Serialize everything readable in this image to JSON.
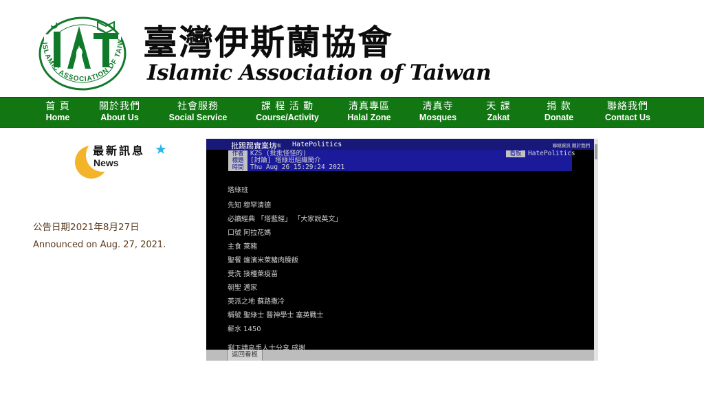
{
  "header": {
    "logo_letters": "IAT",
    "logo_ring_text": "ISLAMIC ASSOCIATION OF TAIWAN",
    "title_zh": "臺灣伊斯蘭協會",
    "title_en": "Islamic Association of Taiwan",
    "brand_green": "#127712"
  },
  "nav": {
    "items": [
      {
        "zh": "首 頁",
        "en": "Home"
      },
      {
        "zh": "關於我們",
        "en": "About Us"
      },
      {
        "zh": "社會服務",
        "en": "Social Service"
      },
      {
        "zh": "課 程 活 動",
        "en": "Course/Activity"
      },
      {
        "zh": "清真專區",
        "en": "Halal Zone"
      },
      {
        "zh": "清真寺",
        "en": "Mosques"
      },
      {
        "zh": "天 課",
        "en": "Zakat"
      },
      {
        "zh": "捐 款",
        "en": "Donate"
      },
      {
        "zh": "聯絡我們",
        "en": "Contact Us"
      }
    ]
  },
  "news": {
    "title_zh": "最新訊息",
    "title_en": "News",
    "star_icon": "star-icon",
    "moon_icon": "crescent-moon-icon"
  },
  "announcement": {
    "date_zh": "公告日期2021年8月27日",
    "date_en": "Announced on Aug. 27, 2021."
  },
  "ptt": {
    "site": "批踢踢實業坊",
    "board_label": "看板",
    "board": "HatePolitics",
    "top_links": "聯絡資訊  關於我們",
    "meta": {
      "author_label": "作者",
      "author": "KZS (批批怪怪的)",
      "title_label": "標題",
      "title": "[討論] 塔綠班組織簡介",
      "time_label": "時間",
      "time": "Thu Aug 26 15:29:24 2021",
      "board_label": "看板",
      "board": "HatePolitics"
    },
    "lines": [
      "塔綠班",
      "先知  穆罕清德",
      "必讀經典 「塔藍經」 「大家說英文」",
      "口號  阿拉花媽",
      "主食  萊豬",
      "聖餐  爐濱米萊豬肉臊飯",
      "受洗  接種萊疫苗",
      "朝聖  邁家",
      "英派之地  蘇路撒冷",
      "稱號  聖綠士  醫神學士  塞英戰士",
      "薪水  1450",
      "剩下請高手人士分享  感謝"
    ],
    "back_button": "返回看板"
  }
}
